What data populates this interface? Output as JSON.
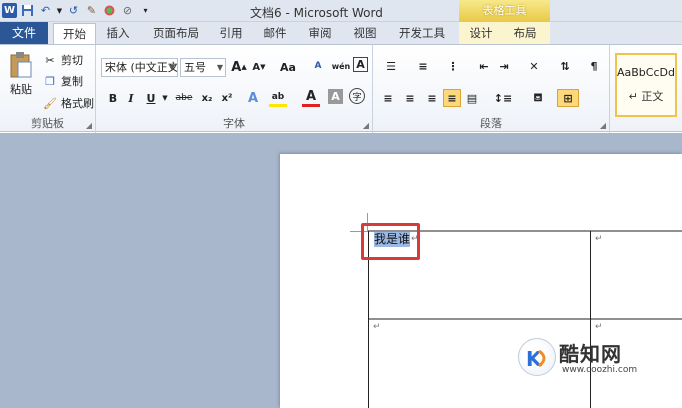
{
  "window": {
    "title": "文档6 - Microsoft Word",
    "context_tools_label": "表格工具"
  },
  "quick_access": {
    "icons": [
      "word-app-icon",
      "save-icon",
      "undo-icon",
      "redo-icon",
      "format-painter-icon",
      "color-icon",
      "no-icon",
      "customize-icon"
    ]
  },
  "tabs": {
    "file": "文件",
    "home": "开始",
    "insert": "插入",
    "page_layout": "页面布局",
    "references": "引用",
    "mailings": "邮件",
    "review": "审阅",
    "view": "视图",
    "developer": "开发工具",
    "design": "设计",
    "layout": "布局"
  },
  "clipboard": {
    "paste": "粘贴",
    "cut": "剪切",
    "copy": "复制",
    "format_painter": "格式刷",
    "group": "剪贴板"
  },
  "font": {
    "name": "宋体 (中文正文",
    "size": "五号",
    "group": "字体",
    "grow": "A",
    "shrink": "A",
    "change_case": "Aa",
    "clear": "A",
    "bold": "B",
    "italic": "I",
    "underline": "U",
    "strike": "abe",
    "subscript": "x₂",
    "superscript": "x²",
    "effects": "A",
    "highlight": "ab",
    "color": "A",
    "shading": "A",
    "enclose": "字",
    "phonetic": "wén",
    "border": "A"
  },
  "paragraph": {
    "group": "段落"
  },
  "styles": {
    "sample": "AaBbCcDd",
    "name": "↵ 正文"
  },
  "document": {
    "selected_text": "我是谁",
    "paragraph_mark": "↵",
    "cell_marks": [
      "↵",
      "↵",
      "↵"
    ]
  },
  "watermark": {
    "name": "酷知网",
    "url": "www.coozhi.com"
  },
  "colors": {
    "file_tab": "#2b5797",
    "context_tab": "#e9c946",
    "highlight_border": "#d83a3a",
    "selection": "#9cb8e4",
    "workspace": "#a8b7cc"
  }
}
